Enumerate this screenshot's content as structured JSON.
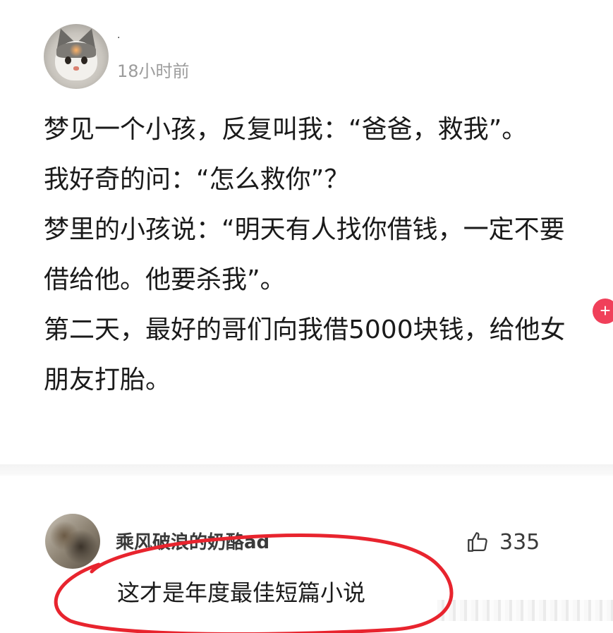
{
  "post": {
    "username": "·",
    "time": "18小时前",
    "lines": [
      "梦见一个小孩，反复叫我：“爸爸，救我”。",
      "我好奇的问：“怎么救你”？",
      "梦里的小孩说：“明天有人找你借钱，一定不要",
      "借给他。他要杀我”。",
      "第二天，最好的哥们向我借5000块钱，给他女",
      "朋友打胎。"
    ]
  },
  "float_button": {
    "label": "+"
  },
  "comment": {
    "username": "乘风破浪的奶酪ad",
    "text": "这才是年度最佳短篇小说",
    "like_count": "335"
  },
  "colors": {
    "annotation_circle": "#e8242e",
    "float_button": "#f0405a",
    "time_text": "#9c9c9c"
  },
  "icons": {
    "like": "thumbs-up-icon",
    "float": "plus-icon"
  }
}
